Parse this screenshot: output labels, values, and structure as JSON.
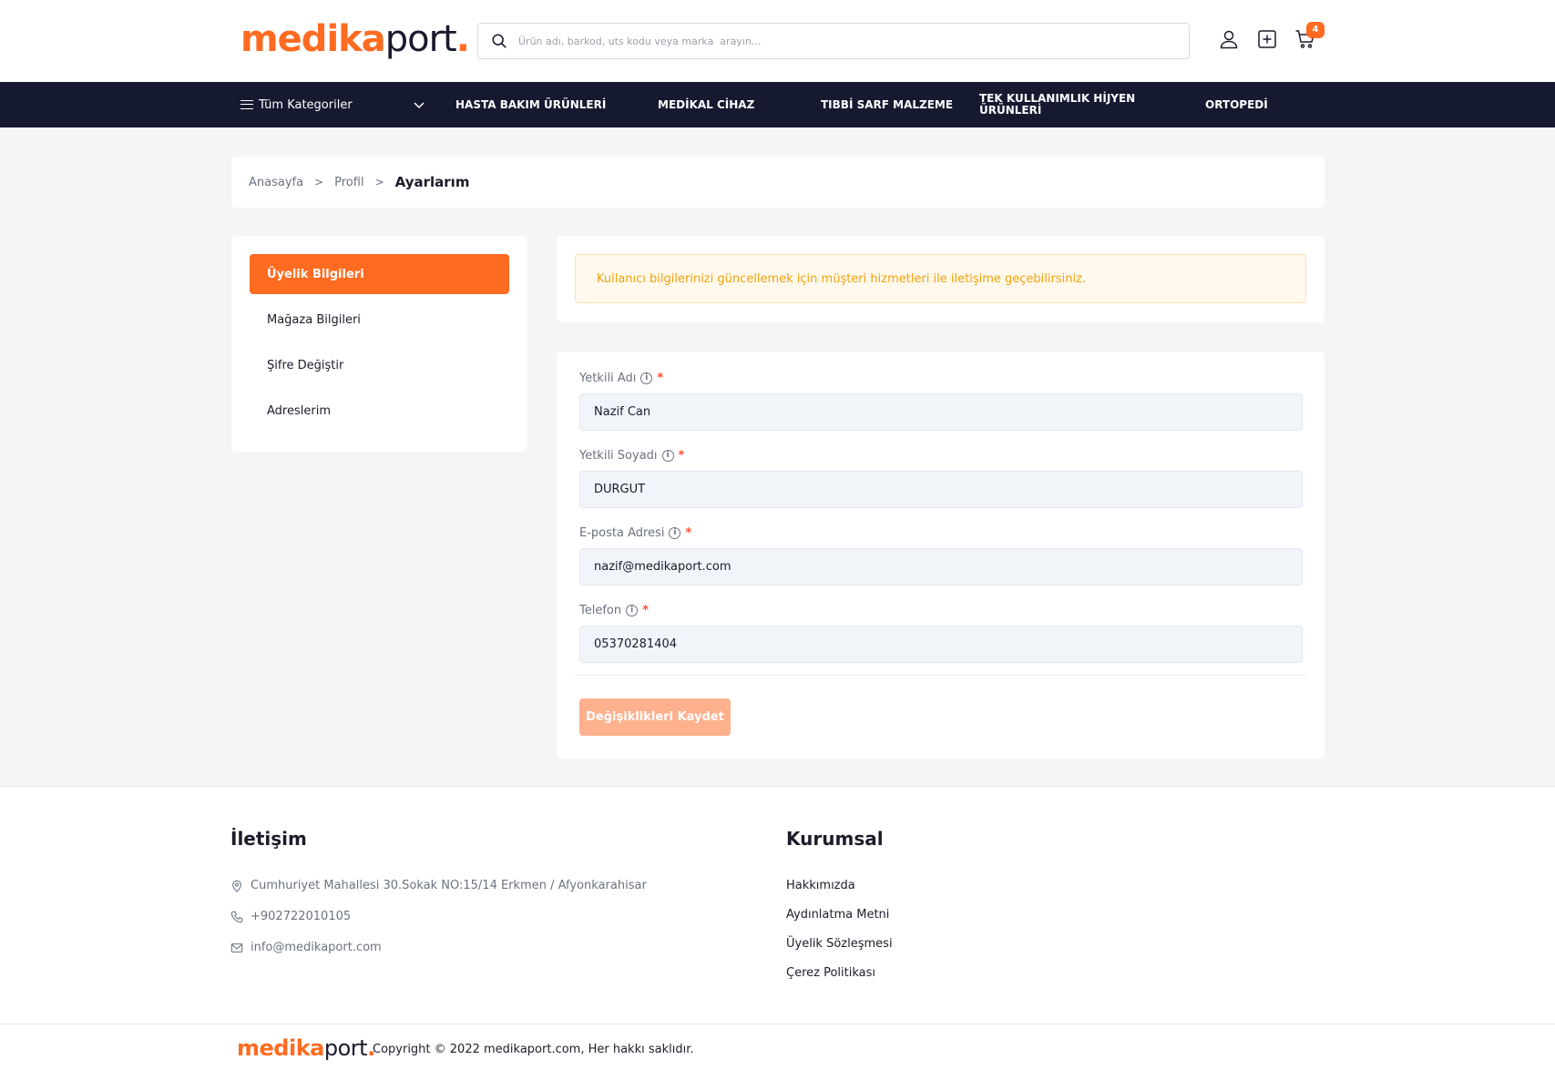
{
  "header": {
    "logo": {
      "part1": "medika",
      "part2": "port",
      "part3": "."
    },
    "search_placeholder": "Ürün adı, barkod, uts kodu veya marka  arayın...",
    "cart_count": "4"
  },
  "nav": {
    "all_categories": "Tüm Kategoriler",
    "items": [
      "HASTA BAKIM ÜRÜNLERİ",
      "MEDİKAL CİHAZ",
      "TIBBİ SARF MALZEME",
      "TEK KULLANIMLIK HİJYEN ÜRÜNLERİ",
      "ORTOPEDİ"
    ]
  },
  "breadcrumb": {
    "items": [
      "Anasayfa",
      "Profil"
    ],
    "separator": ">",
    "current": "Ayarlarım"
  },
  "sidebar": {
    "items": [
      "Üyelik Bilgileri",
      "Mağaza Bilgileri",
      "Şifre Değiştir",
      "Adreslerim"
    ],
    "active_index": 0
  },
  "alert": {
    "text": "Kullanıcı bilgilerinizi güncellemek için müşteri hizmetleri ile iletişime geçebilirsiniz."
  },
  "form": {
    "fields": [
      {
        "label": "Yetkili Adı",
        "value": "Nazif Can"
      },
      {
        "label": "Yetkili Soyadı",
        "value": "DURGUT"
      },
      {
        "label": "E-posta Adresi",
        "value": "nazif@medikaport.com"
      },
      {
        "label": "Telefon",
        "value": "05370281404"
      }
    ],
    "required_mark": "*",
    "info_glyph": "i",
    "save_label": "Değişiklikleri Kaydet"
  },
  "footer": {
    "contact_title": "İletişim",
    "address": "Cumhuriyet Mahallesi 30.Sokak NO:15/14 Erkmen / Afyonkarahisar",
    "phone": "+902722010105",
    "email": "info@medikaport.com",
    "corporate_title": "Kurumsal",
    "links": [
      "Hakkımızda",
      "Aydınlatma Metni",
      "Üyelik Sözleşmesi",
      "Çerez Politikası"
    ],
    "copyright": "Copyright © 2022 medikaport.com, Her hakkı saklıdır."
  },
  "colors": {
    "accent": "#ff6b21",
    "nav_bg": "#151a30",
    "alert_text": "#f0a30a",
    "alert_bg": "#fff8ec",
    "save_button_disabled": "#ffb08d"
  }
}
